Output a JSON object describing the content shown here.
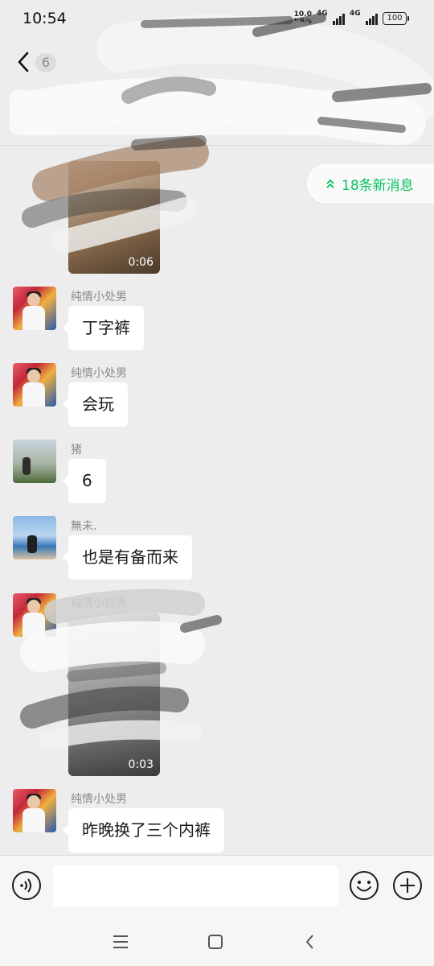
{
  "status_bar": {
    "time": "10:54",
    "net_speed_value": "10.0",
    "net_speed_unit": "KB/s",
    "signal1_label": "4G",
    "signal2_label": "4G",
    "battery": "100"
  },
  "title_bar": {
    "title": "6",
    "back_icon": "chevron-left-icon"
  },
  "new_messages": {
    "label": "18条新消息",
    "icon": "double-chevron-up-icon",
    "color": "#07c160"
  },
  "messages": [
    {
      "type": "video",
      "duration": "0:06"
    },
    {
      "type": "text",
      "sender": "纯情小处男",
      "text": "丁字裤"
    },
    {
      "type": "text",
      "sender": "纯情小处男",
      "text": "会玩"
    },
    {
      "type": "text",
      "sender": "猪",
      "text": "6"
    },
    {
      "type": "text",
      "sender": "無未.",
      "text": "也是有备而来"
    },
    {
      "type": "video",
      "sender": "纯情小处男",
      "duration": "0:03"
    },
    {
      "type": "text",
      "sender": "纯情小处男",
      "text": "昨晚换了三个内裤"
    }
  ],
  "input_bar": {
    "value": "",
    "voice_icon": "voice-icon",
    "emoji_icon": "emoji-icon",
    "plus_icon": "plus-icon"
  },
  "nav_bar": {
    "icons": [
      "menu-icon",
      "home-icon",
      "back-icon"
    ]
  },
  "colors": {
    "background": "#ededed",
    "bubble": "#ffffff",
    "accent": "#07c160"
  }
}
